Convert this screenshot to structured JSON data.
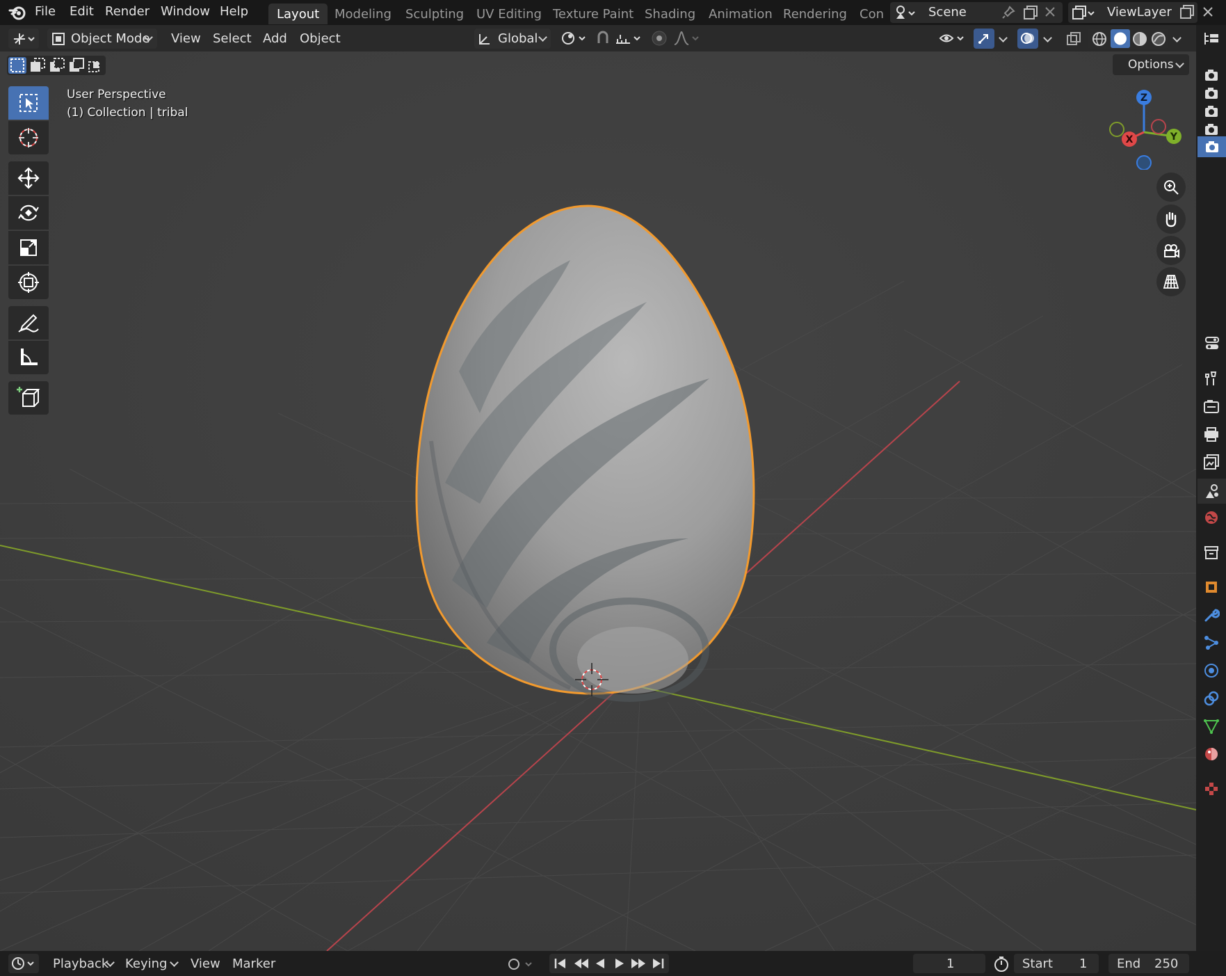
{
  "menu": [
    "File",
    "Edit",
    "Render",
    "Window",
    "Help"
  ],
  "workspaces": {
    "active": "Layout",
    "tabs": [
      "Layout",
      "Modeling",
      "Sculpting",
      "UV Editing",
      "Texture Paint",
      "Shading",
      "Animation",
      "Rendering",
      "Con"
    ]
  },
  "scene": {
    "label": "Scene"
  },
  "view_layer": {
    "label": "ViewLayer"
  },
  "header": {
    "mode": "Object Mode",
    "menus": [
      "View",
      "Select",
      "Add",
      "Object"
    ],
    "transform_orientation": "Global",
    "options_label": "Options"
  },
  "viewport": {
    "perspective_label": "User Perspective",
    "collection_label": "(1) Collection | tribal",
    "axes": {
      "x": "X",
      "y": "Y",
      "z": "Z"
    },
    "colors": {
      "background": "#3d3d3d",
      "grid": "#4a4a4a",
      "x_axis": "#b8444c",
      "y_axis": "#7f9c2a",
      "selection_outline": "#f29a2e",
      "active_tool": "#4772b3"
    }
  },
  "tools": [
    "select-box",
    "cursor",
    "move",
    "rotate",
    "scale",
    "transform",
    "annotate",
    "measure",
    "add-cube"
  ],
  "timeline": {
    "playback_label": "Playback",
    "keying_label": "Keying",
    "view_label": "View",
    "marker_label": "Marker",
    "current_frame": "1",
    "start_label": "Start",
    "start_value": "1",
    "end_label": "End",
    "end_value": "250"
  }
}
